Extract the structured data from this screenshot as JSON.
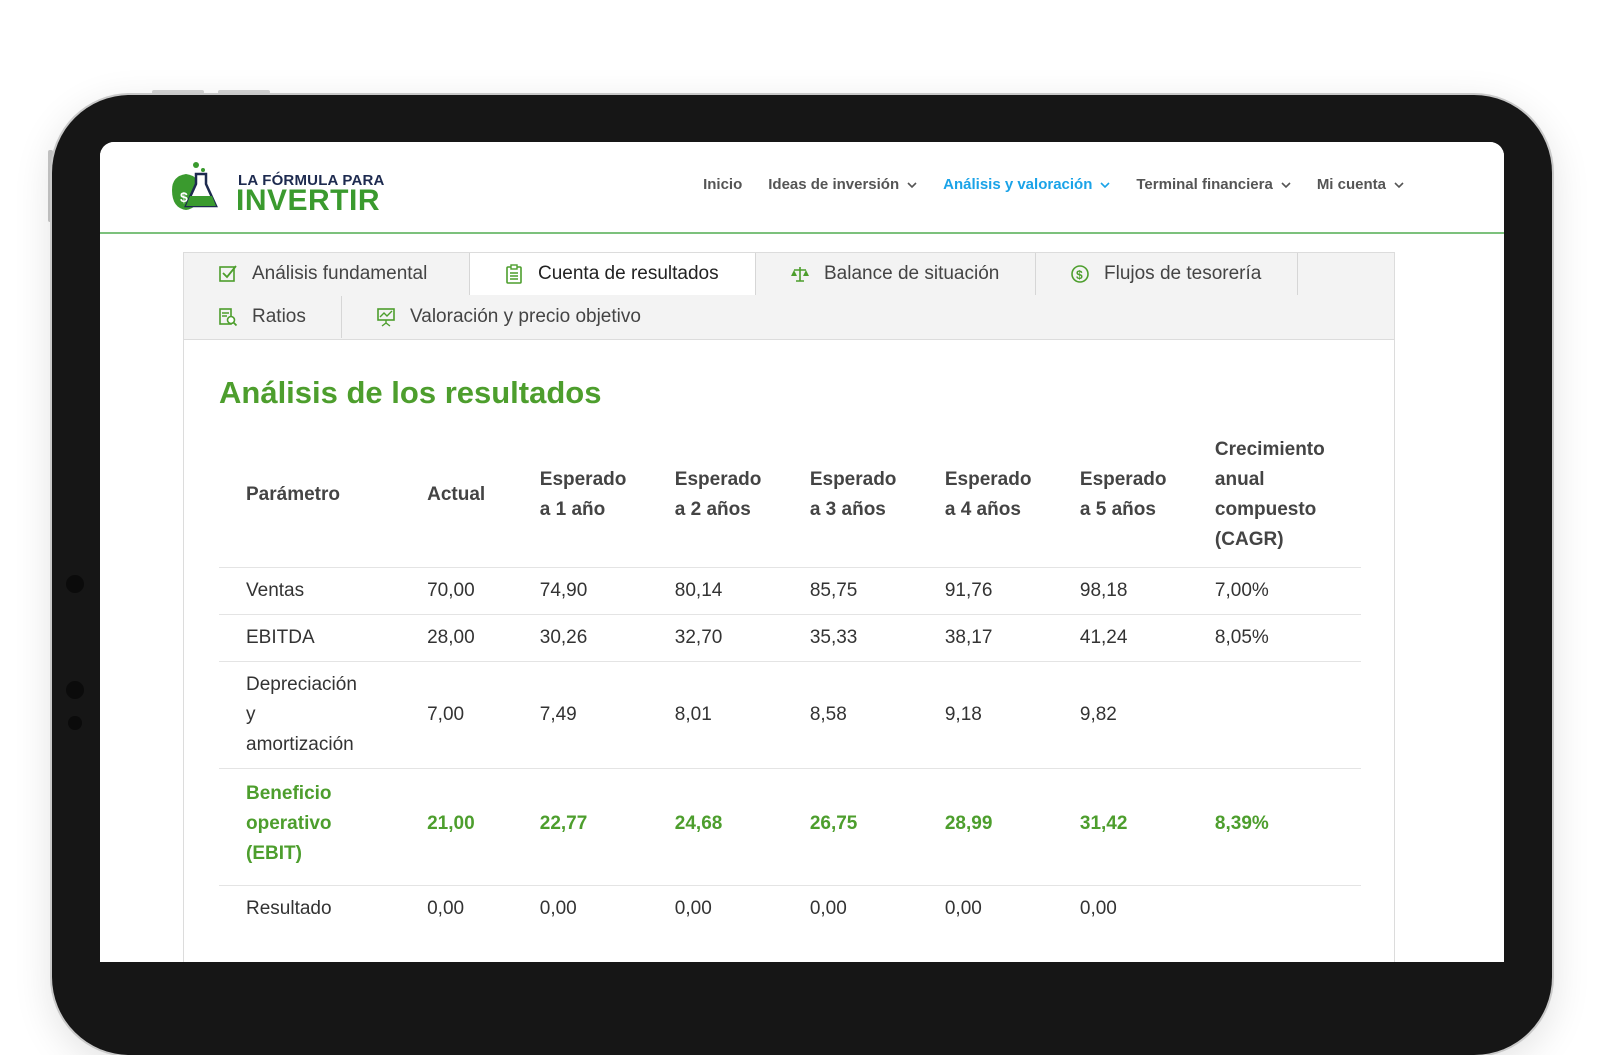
{
  "logo": {
    "line1": "LA FÓRMULA PARA",
    "line2": "INVERTIR"
  },
  "nav": {
    "items": [
      {
        "label": "Inicio",
        "has_dropdown": false,
        "active": false
      },
      {
        "label": "Ideas de inversión",
        "has_dropdown": true,
        "active": false
      },
      {
        "label": "Análisis y valoración",
        "has_dropdown": true,
        "active": true
      },
      {
        "label": "Terminal financiera",
        "has_dropdown": true,
        "active": false
      },
      {
        "label": "Mi cuenta",
        "has_dropdown": true,
        "active": false
      }
    ]
  },
  "tabs": [
    {
      "label": "Análisis fundamental",
      "icon": "checkbox-icon",
      "active": false
    },
    {
      "label": "Cuenta de resultados",
      "icon": "clipboard-icon",
      "active": true
    },
    {
      "label": "Balance de situación",
      "icon": "scale-icon",
      "active": false
    },
    {
      "label": "Flujos de tesorería",
      "icon": "dollar-circle-icon",
      "active": false
    },
    {
      "label": "Ratios",
      "icon": "document-search-icon",
      "active": false
    },
    {
      "label": "Valoración y precio objetivo",
      "icon": "chart-presentation-icon",
      "active": false
    }
  ],
  "section": {
    "title": "Análisis de los resultados"
  },
  "table": {
    "headers": [
      "Parámetro",
      "Actual",
      "Esperado a 1 año",
      "Esperado a 2 años",
      "Esperado a 3 años",
      "Esperado a 4 años",
      "Esperado a 5 años",
      "Crecimiento anual compuesto (CAGR)"
    ],
    "rows": [
      {
        "cells": [
          "Ventas",
          "70,00",
          "74,90",
          "80,14",
          "85,75",
          "91,76",
          "98,18",
          "7,00%"
        ],
        "highlight": false
      },
      {
        "cells": [
          "EBITDA",
          "28,00",
          "30,26",
          "32,70",
          "35,33",
          "38,17",
          "41,24",
          "8,05%"
        ],
        "highlight": false
      },
      {
        "cells": [
          "Depreciación y amortización",
          "7,00",
          "7,49",
          "8,01",
          "8,58",
          "9,18",
          "9,82",
          ""
        ],
        "highlight": false
      },
      {
        "cells": [
          "Beneficio operativo (EBIT)",
          "21,00",
          "22,77",
          "24,68",
          "26,75",
          "28,99",
          "31,42",
          "8,39%"
        ],
        "highlight": true
      },
      {
        "cells": [
          "Resultado",
          "0,00",
          "0,00",
          "0,00",
          "0,00",
          "0,00",
          "0,00",
          ""
        ],
        "highlight": false
      }
    ]
  },
  "colors": {
    "brand_green": "#4d9e2d",
    "active_nav": "#1aa3e8",
    "logo_navy": "#1d2a4f"
  }
}
